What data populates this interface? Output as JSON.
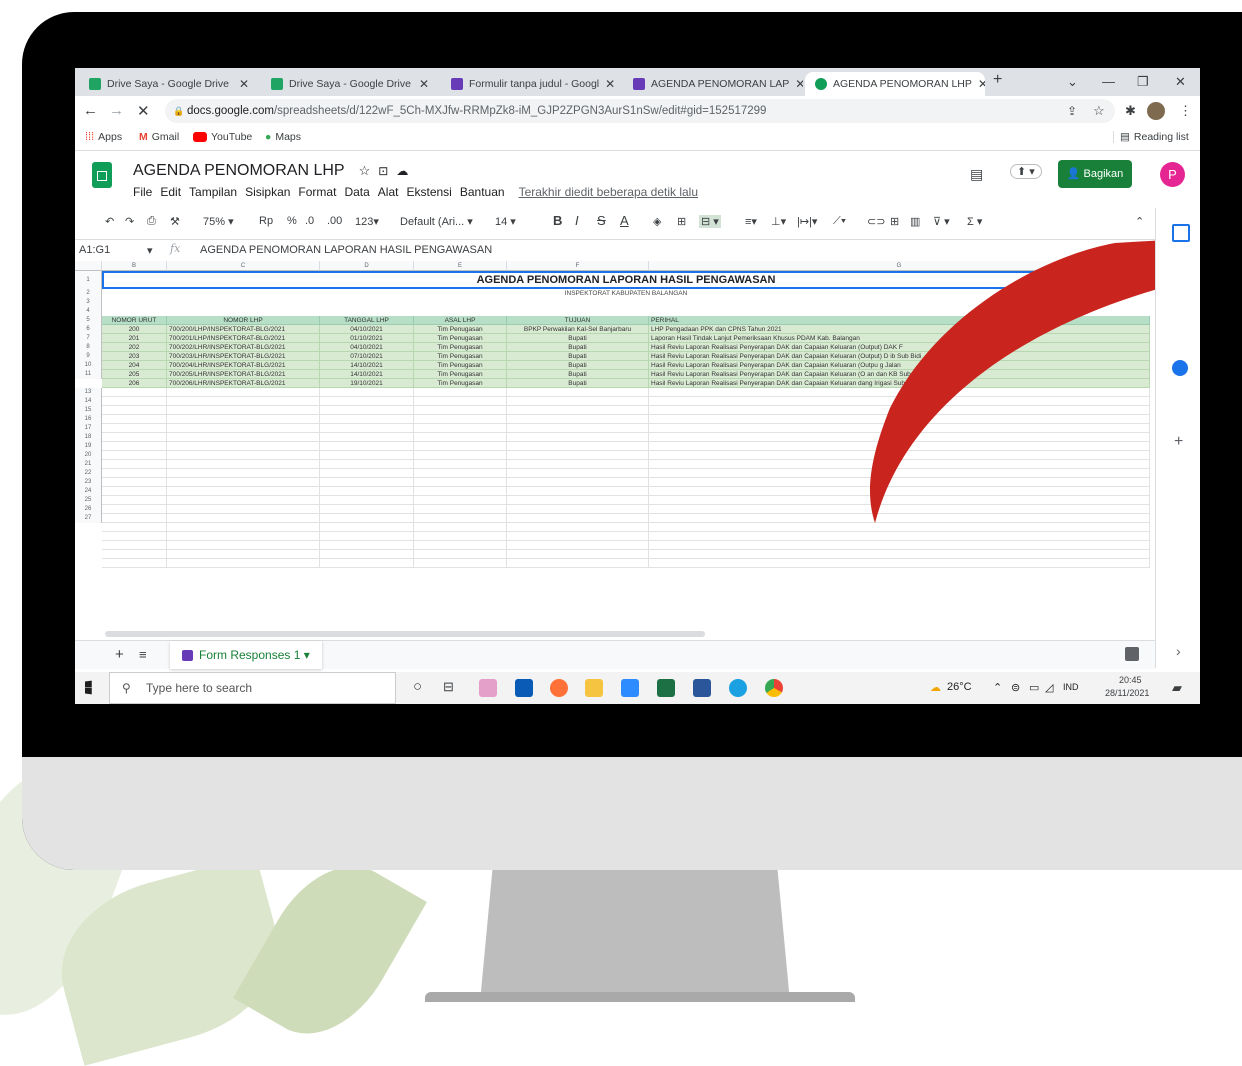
{
  "browser": {
    "tabs": [
      {
        "title": "Drive Saya - Google Drive",
        "icon": "google-drive-icon",
        "color": "#1fa463"
      },
      {
        "title": "Drive Saya - Google Drive",
        "icon": "google-drive-icon",
        "color": "#1fa463"
      },
      {
        "title": "Formulir tanpa judul - Googl",
        "icon": "google-forms-icon",
        "color": "#673ab7"
      },
      {
        "title": "AGENDA PENOMORAN LAP",
        "icon": "google-forms-icon",
        "color": "#673ab7"
      },
      {
        "title": "AGENDA PENOMORAN LHP",
        "icon": "loading-icon",
        "color": "#0f9d58"
      }
    ],
    "new_tab": "+",
    "url_host": "docs.google.com",
    "url_path": "/spreadsheets/d/122wF_5Ch-MXJfw-RRMpZk8-iM_GJP2ZPGN3AurS1nSw/edit#gid=152517299",
    "bookmarks": [
      {
        "label": "Apps",
        "icon": "apps-grid-icon"
      },
      {
        "label": "Gmail",
        "icon": "gmail-icon"
      },
      {
        "label": "YouTube",
        "icon": "youtube-icon"
      },
      {
        "label": "Maps",
        "icon": "maps-pin-icon"
      }
    ],
    "reading_list": "Reading list"
  },
  "sheet": {
    "title": "AGENDA PENOMORAN LHP",
    "menus": [
      "File",
      "Edit",
      "Tampilan",
      "Sisipkan",
      "Format",
      "Data",
      "Alat",
      "Ekstensi",
      "Bantuan"
    ],
    "last_edit": "Terakhir diedit beberapa detik lalu",
    "share_label": "Bagikan",
    "avatar_letter": "P",
    "toolbar": {
      "zoom": "75%",
      "currency": "Rp",
      "percent": "%",
      "dec_less": ".0",
      "dec_more": ".00",
      "number_format": "123",
      "font": "Default (Ari...",
      "font_size": "14",
      "bold": "B",
      "italic": "I",
      "strike": "S",
      "text_color": "A",
      "sum": "Σ"
    },
    "name_box": "A1:G1",
    "formula": "AGENDA PENOMORAN LAPORAN HASIL PENGAWASAN",
    "col_letters": [
      "B",
      "C",
      "D",
      "E",
      "F",
      "G"
    ],
    "title_row": "AGENDA PENOMORAN LAPORAN HASIL PENGAWASAN",
    "subtitle_row": "INSPEKTORAT KABUPATEN BALANGAN",
    "headers": [
      "NOMOR URUT",
      "NOMOR LHP",
      "TANGGAL LHP",
      "ASAL LHP",
      "TUJUAN",
      "PERIHAL"
    ],
    "rows": [
      [
        "200",
        "700/200/LHP/INSPEKTORAT-BLG/2021",
        "04/10/2021",
        "Tim Penugasan",
        "BPKP Perwakilan Kal-Sel Banjarbaru",
        "LHP Pengadaan PPK dan CPNS Tahun 2021"
      ],
      [
        "201",
        "700/201/LHP/INSPEKTORAT-BLG/2021",
        "01/10/2021",
        "Tim Penugasan",
        "Bupati",
        "Laporan Hasil Tindak Lanjut Pemeriksaan Khusus PDAM Kab. Balangan"
      ],
      [
        "202",
        "700/202/LHR/INSPEKTORAT-BLG/2021",
        "04/10/2021",
        "Tim Penugasan",
        "Bupati",
        "Hasil Reviu Laporan Realisasi Penyerapan DAK dan Capaian Keluaran (Output) DAK F"
      ],
      [
        "203",
        "700/203/LHR/INSPEKTORAT-BLG/2021",
        "07/10/2021",
        "Tim Penugasan",
        "Bupati",
        "Hasil Reviu Laporan Realisasi Penyerapan DAK dan Capaian Keluaran (Output) D                                      ib Sub Bidi"
      ],
      [
        "204",
        "700/204/LHR/INSPEKTORAT-BLG/2021",
        "14/10/2021",
        "Tim Penugasan",
        "Bupati",
        "Hasil Reviu Laporan Realisasi Penyerapan DAK dan Capaian Keluaran (Outpu                              g Jalan"
      ],
      [
        "205",
        "700/205/LHR/INSPEKTORAT-BLG/2021",
        "14/10/2021",
        "Tim Penugasan",
        "Bupati",
        "Hasil Reviu Laporan Realisasi Penyerapan DAK dan Capaian Keluaran (O                           an dan KB Sub Bidang Kase"
      ],
      [
        "206",
        "700/206/LHR/INSPEKTORAT-BLG/2021",
        "19/10/2021",
        "Tim Penugasan",
        "Bupati",
        "Hasil Reviu Laporan Realisasi Penyerapan DAK dan Capaian Keluaran                    dang Irigasi Sub Bidang Irigasi Tah"
      ]
    ],
    "row_numbers": [
      "1",
      "2",
      "3",
      "4",
      "5",
      "6",
      "7",
      "8",
      "9",
      "10",
      "11",
      "13",
      "14",
      "15",
      "16",
      "17",
      "18",
      "19",
      "20",
      "21",
      "22",
      "23",
      "24",
      "25",
      "26",
      "27"
    ],
    "sheet_tab": "Form Responses 1"
  },
  "taskbar": {
    "search_placeholder": "Type here to search",
    "weather": "26°C",
    "lang": "IND",
    "time": "20:45",
    "date": "28/11/2021"
  },
  "colors": {
    "green_header": "#b7dfc7",
    "green_fill": "#d9ead3",
    "share_green": "#188038",
    "arrow_red": "#c9241d"
  }
}
